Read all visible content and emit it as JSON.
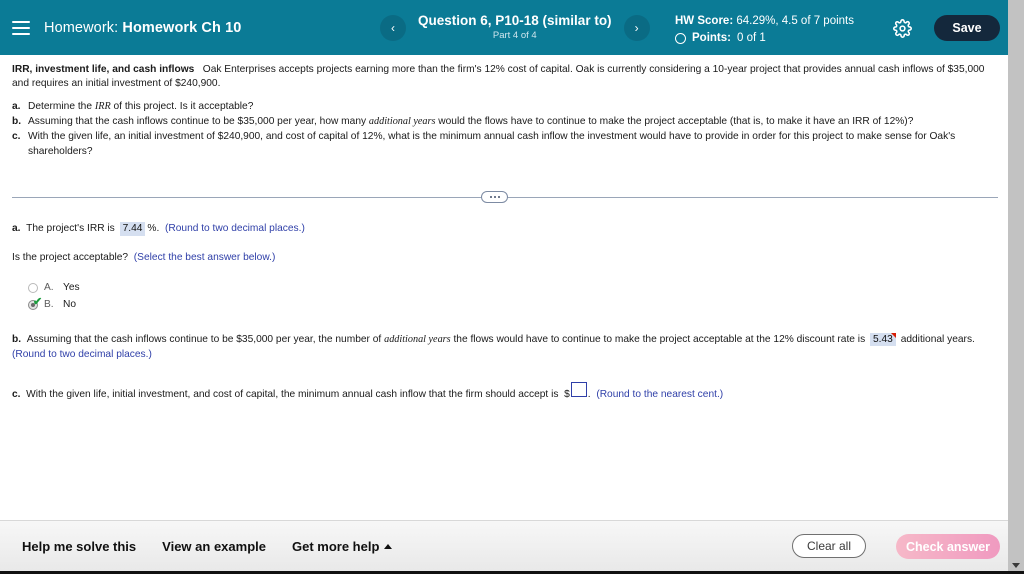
{
  "header": {
    "menu_icon": "hamburger-icon",
    "title_label": "Homework:",
    "title_name": "Homework Ch 10",
    "prev_icon": "‹",
    "next_icon": "›",
    "question_title": "Question 6, P10-18 (similar to)",
    "question_part": "Part 4 of 4",
    "hw_score_label": "HW Score:",
    "hw_score_value": "64.29%, 4.5 of 7 points",
    "points_label": "Points:",
    "points_value": "0 of 1",
    "settings_icon": "gear-icon",
    "save_label": "Save",
    "bg_color": "#0b7b96",
    "save_bg_color": "#14283c"
  },
  "stem": {
    "bold_lead": "IRR, investment life, and cash inflows",
    "body": "Oak Enterprises accepts projects earning more than the firm's 12% cost of capital.  Oak is currently considering a 10-year project that provides annual cash inflows of $35,000 and requires an initial investment of $240,900."
  },
  "parts": [
    {
      "letter": "a.",
      "pre": "Determine the ",
      "italic": "IRR",
      "post": " of this project.  Is it acceptable?"
    },
    {
      "letter": "b.",
      "pre": "Assuming that the cash inflows continue to be $35,000 per year, how many ",
      "italic": "additional years",
      "post": " would the flows have to continue to make the project acceptable (that is, to make it have an IRR of 12%)?"
    },
    {
      "letter": "c.",
      "pre": "With the given life, an initial investment of $240,900, and cost of capital of 12%, what is the minimum annual cash inflow  the investment would have to provide in order for this project to make sense for Oak's shareholders?",
      "italic": "",
      "post": ""
    }
  ],
  "divider": {
    "dots_icon": "ellipsis-pill-icon"
  },
  "answers": {
    "a": {
      "letter": "a.",
      "text_before": "The project's IRR is",
      "value": "7.44",
      "unit": "%.",
      "hint": "(Round to two decimal places.)",
      "prompt": "Is the project acceptable?",
      "prompt_hint": "(Select the best answer below.)",
      "choices": [
        {
          "letter": "A.",
          "label": "Yes",
          "selected": false,
          "correct": false
        },
        {
          "letter": "B.",
          "label": "No",
          "selected": true,
          "correct": true
        }
      ]
    },
    "b": {
      "letter": "b.",
      "text_before": "Assuming that the cash inflows continue to be $35,000 per year, the number of",
      "italic": "additional years",
      "text_mid": "the flows would have to continue to make the project acceptable at the 12% discount rate is",
      "value": "5.43",
      "text_after": "additional years.",
      "hint": "(Round to two decimal places.)",
      "flagged": true
    },
    "c": {
      "letter": "c.",
      "text_before": "With the given life, initial investment, and cost of capital, the minimum annual cash inflow that the firm should accept is",
      "currency": "$",
      "value": "",
      "placeholder": "",
      "period": ".",
      "hint": "(Round to the nearest cent.)"
    },
    "highlight_color": "#d5dff0",
    "link_color": "#2f3fa8",
    "flag_color": "#d81e05"
  },
  "footer": {
    "help_me_solve": "Help me solve this",
    "view_example": "View an example",
    "get_more_help": "Get more help",
    "get_more_help_icon": "caret-up-icon",
    "clear_all": "Clear all",
    "check_answer": "Check answer"
  },
  "scrollbar": {
    "down_arrow_icon": "caret-down-icon"
  }
}
